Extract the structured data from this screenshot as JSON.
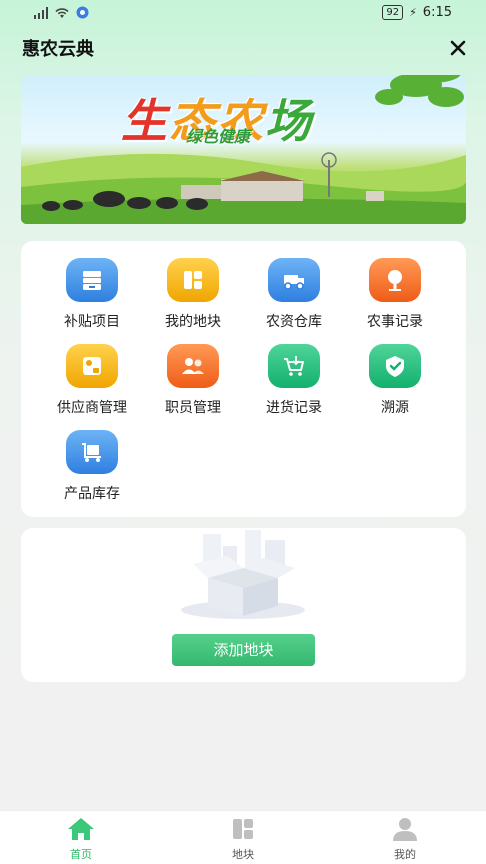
{
  "status_bar": {
    "battery": "92",
    "time": "6:15"
  },
  "header": {
    "title": "惠农云典",
    "close_icon": "close-icon"
  },
  "banner": {
    "title_chars": [
      "生",
      "态",
      "农",
      "场"
    ],
    "subtitle": "绿色健康"
  },
  "menu": {
    "items": [
      {
        "label": "补贴项目",
        "icon": "archive-icon",
        "color": "blue"
      },
      {
        "label": "我的地块",
        "icon": "land-plots-icon",
        "color": "yellow"
      },
      {
        "label": "农资仓库",
        "icon": "tractor-icon",
        "color": "blue"
      },
      {
        "label": "农事记录",
        "icon": "tree-icon",
        "color": "orange"
      },
      {
        "label": "供应商管理",
        "icon": "supplier-icon",
        "color": "yellow"
      },
      {
        "label": "职员管理",
        "icon": "staff-icon",
        "color": "orange"
      },
      {
        "label": "进货记录",
        "icon": "cart-icon",
        "color": "green"
      },
      {
        "label": "溯源",
        "icon": "shield-check-icon",
        "color": "green"
      },
      {
        "label": "产品库存",
        "icon": "delivery-cart-icon",
        "color": "blue"
      }
    ]
  },
  "empty_state": {
    "button_label": "添加地块",
    "illustration": "empty-box-icon"
  },
  "bottom_nav": {
    "items": [
      {
        "label": "首页",
        "icon": "home-icon",
        "active": true
      },
      {
        "label": "地块",
        "icon": "plots-icon",
        "active": false
      },
      {
        "label": "我的",
        "icon": "user-icon",
        "active": false
      }
    ]
  },
  "colors": {
    "accent": "#34b86f",
    "inactive": "#555555"
  }
}
